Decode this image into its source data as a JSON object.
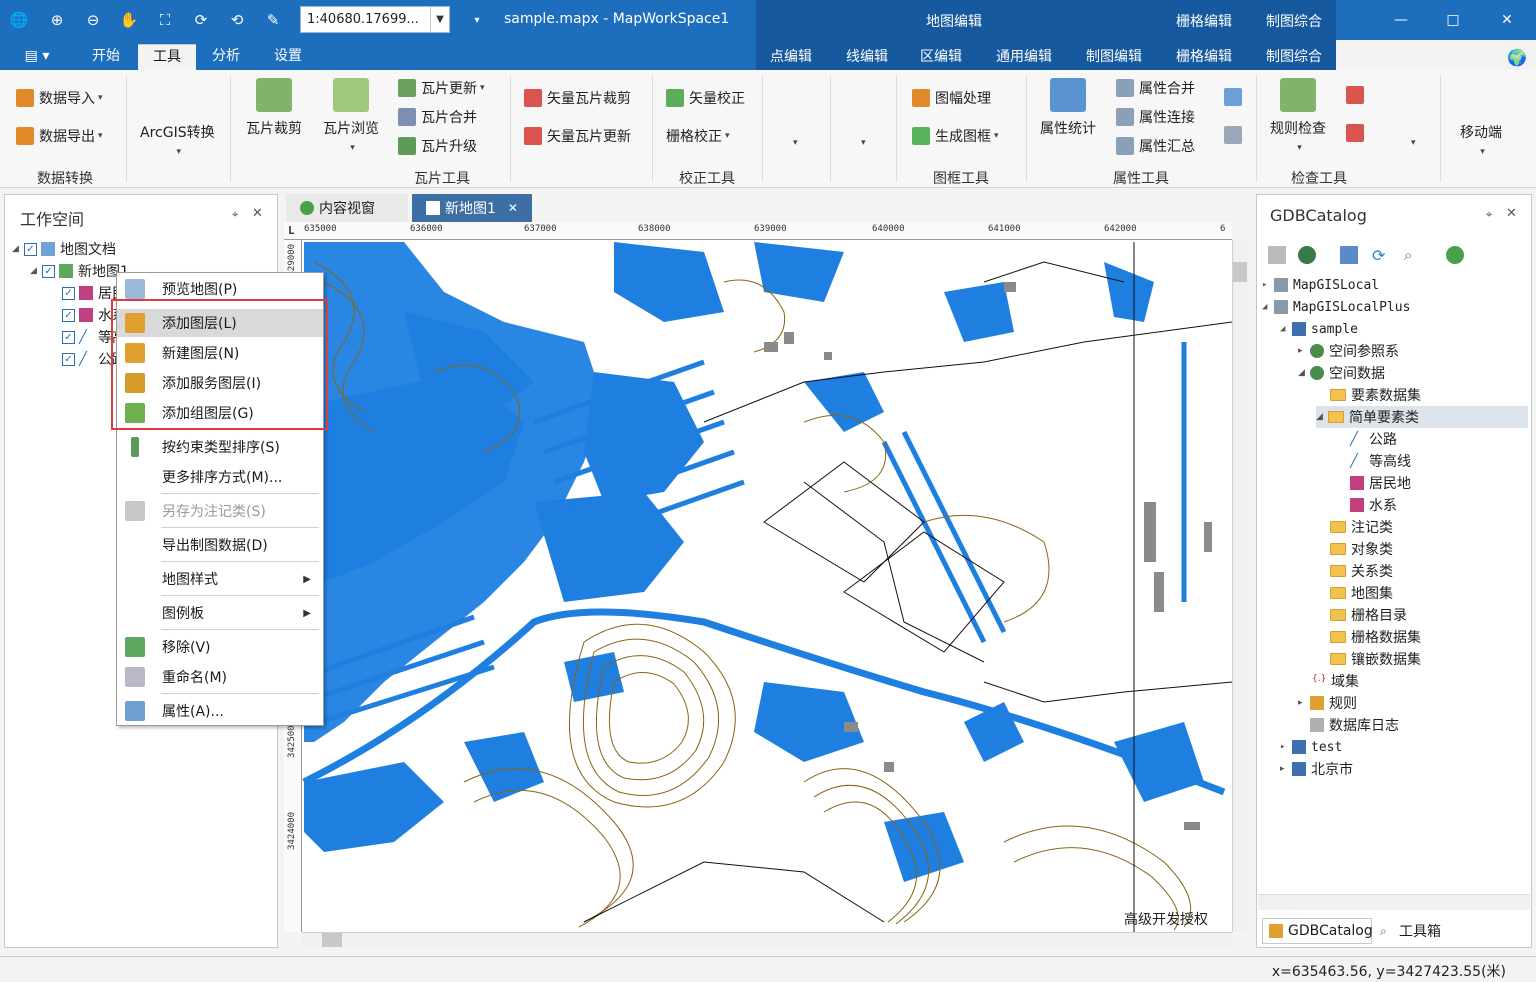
{
  "window": {
    "title": "sample.mapx - MapWorkSpace1",
    "scale_value": "1:40680.17699...",
    "contextual_group_title": "地图编辑",
    "contextual_titles": [
      "栅格编辑",
      "制图综合"
    ],
    "controls": {
      "minimize": "—",
      "maximize": "□",
      "close": "✕"
    }
  },
  "tabs": {
    "file_menu": "▤ ▾",
    "items": [
      "开始",
      "工具",
      "分析",
      "设置"
    ],
    "active": "工具",
    "contextual": [
      "点编辑",
      "线编辑",
      "区编辑",
      "通用编辑",
      "制图编辑",
      "栅格编辑",
      "制图综合"
    ]
  },
  "ribbon": {
    "groups": [
      "数据转换",
      "瓦片工具",
      "校正工具",
      "图框工具",
      "属性工具",
      "检查工具"
    ],
    "data_import": "数据导入",
    "data_export": "数据导出",
    "arcgis": "ArcGIS转换",
    "tile_clip": "瓦片裁剪",
    "tile_browse": "瓦片浏览",
    "tile_update": "瓦片更新",
    "tile_merge": "瓦片合并",
    "tile_upgrade": "瓦片升级",
    "vec_tile_clip": "矢量瓦片裁剪",
    "vec_tile_update": "矢量瓦片更新",
    "vec_correct": "矢量校正",
    "raster_correct": "栅格校正",
    "sheet_process": "图幅处理",
    "gen_frame": "生成图框",
    "attr_stats": "属性统计",
    "attr_merge": "属性合并",
    "attr_join": "属性连接",
    "attr_summary": "属性汇总",
    "rule_check": "规则检查",
    "mobile": "移动端"
  },
  "workspace": {
    "title": "工作空间",
    "pin": "⌖",
    "close": "✕",
    "root": "地图文档",
    "map": "新地图1",
    "layers": [
      "居民地",
      "水系",
      "等高线",
      "公路"
    ],
    "layer_visible": [
      true,
      true,
      true,
      true
    ]
  },
  "doc_tabs": {
    "tab1": "内容视窗",
    "tab2": "新地图1",
    "close": "✕"
  },
  "rulers": {
    "x_labels": [
      "635000",
      "636000",
      "637000",
      "638000",
      "639000",
      "640000",
      "641000",
      "642000",
      "6"
    ],
    "y_labels": [
      "3429000",
      "3425000",
      "3424000"
    ],
    "corner": "L"
  },
  "map": {
    "watermark": "高级开发授权"
  },
  "context_menu": [
    {
      "label": "预览地图(P)",
      "icon": "preview-map-icon",
      "enabled": true
    },
    {
      "label": "添加图层(L)",
      "icon": "add-layer-icon",
      "enabled": true,
      "highlighted": true
    },
    {
      "label": "新建图层(N)",
      "icon": "new-layer-icon",
      "enabled": true
    },
    {
      "label": "添加服务图层(I)",
      "icon": "add-service-layer-icon",
      "enabled": true
    },
    {
      "label": "添加组图层(G)",
      "icon": "add-group-layer-icon",
      "enabled": true
    },
    {
      "label": "按约束类型排序(S)",
      "icon": "sort-icon",
      "enabled": true
    },
    {
      "label": "更多排序方式(M)...",
      "icon": "",
      "enabled": true
    },
    {
      "label": "另存为注记类(S)",
      "icon": "save-annotation-icon",
      "enabled": false
    },
    {
      "label": "导出制图数据(D)",
      "icon": "",
      "enabled": true
    },
    {
      "label": "地图样式",
      "icon": "",
      "enabled": true,
      "submenu": true
    },
    {
      "label": "图例板",
      "icon": "",
      "enabled": true,
      "submenu": true
    },
    {
      "label": "移除(V)",
      "icon": "remove-icon",
      "enabled": true
    },
    {
      "label": "重命名(M)",
      "icon": "rename-icon",
      "enabled": true
    },
    {
      "label": "属性(A)...",
      "icon": "properties-icon",
      "enabled": true
    }
  ],
  "catalog": {
    "title": "GDBCatalog",
    "pin": "⌖",
    "close": "✕",
    "nodes": [
      "MapGISLocal",
      "MapGISLocalPlus",
      "sample",
      "空间参照系",
      "空间数据",
      "要素数据集",
      "简单要素类",
      "公路",
      "等高线",
      "居民地",
      "水系",
      "注记类",
      "对象类",
      "关系类",
      "地图集",
      "栅格目录",
      "栅格数据集",
      "镶嵌数据集",
      "域集",
      "规则",
      "数据库日志",
      "test",
      "北京市"
    ],
    "tab_catalog": "GDBCatalog",
    "tab_toolbox": "工具箱"
  },
  "status": {
    "coords": "x=635463.56, y=3427423.55(米)"
  },
  "colors": {
    "titlebar": "#1d6fbd",
    "context_band": "#16599f",
    "water": "#1e7fe0",
    "contour": "#8a6414",
    "highlight_box": "#e23b3b"
  }
}
